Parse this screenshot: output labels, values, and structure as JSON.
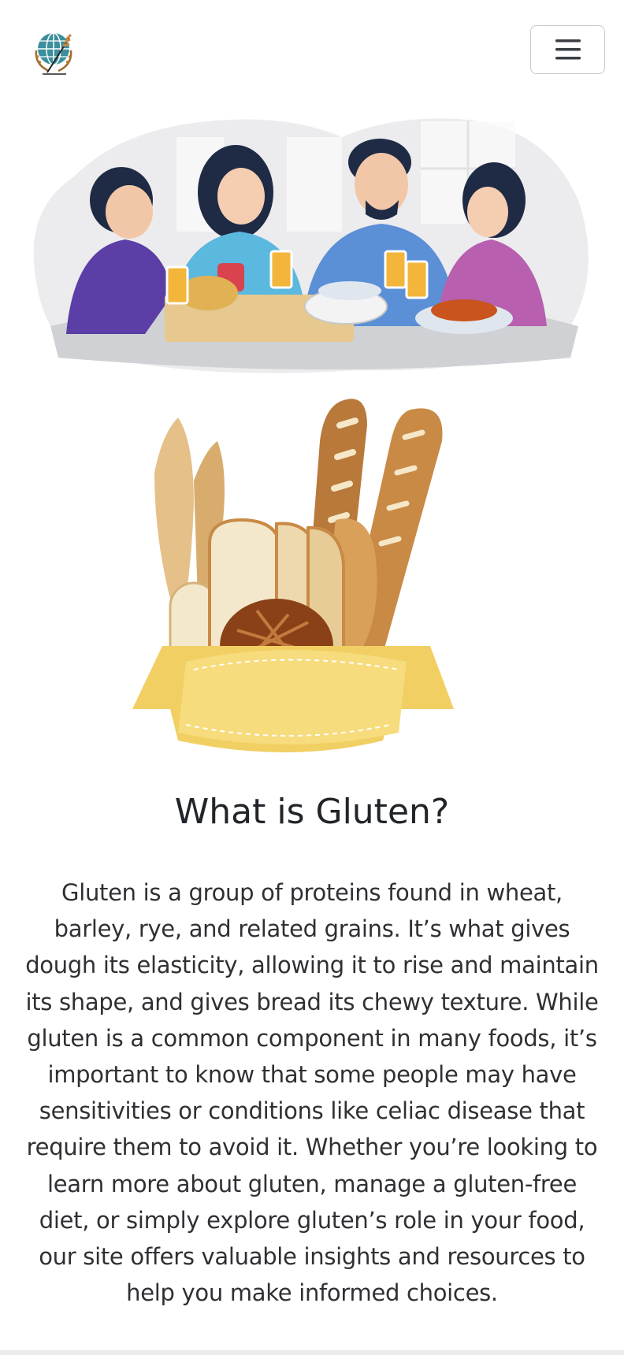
{
  "header": {
    "logo_icon": "globe-wheat-logo-icon",
    "menu_icon": "hamburger-menu-icon"
  },
  "hero": {
    "illustration": "family-dinner-illustration"
  },
  "feature": {
    "illustration": "bread-and-wheat-illustration"
  },
  "content": {
    "title": "What is Gluten?",
    "body": "Gluten is a group of proteins found in wheat, barley, rye, and related grains. It’s what gives dough its elasticity, allowing it to rise and maintain its shape, and gives bread its chewy texture. While gluten is a common component in many foods, it’s important to know that some people may have sensitivities or conditions like celiac disease that require them to avoid it. Whether you’re looking to learn more about gluten, manage a gluten-free diet, or simply explore gluten’s role in your food, our site offers valuable insights and resources to help you make informed choices."
  },
  "colors": {
    "text": "#212529",
    "ribbon": "#f7dc7d",
    "bread": "#c98a45",
    "teal": "#3c8f9c"
  }
}
